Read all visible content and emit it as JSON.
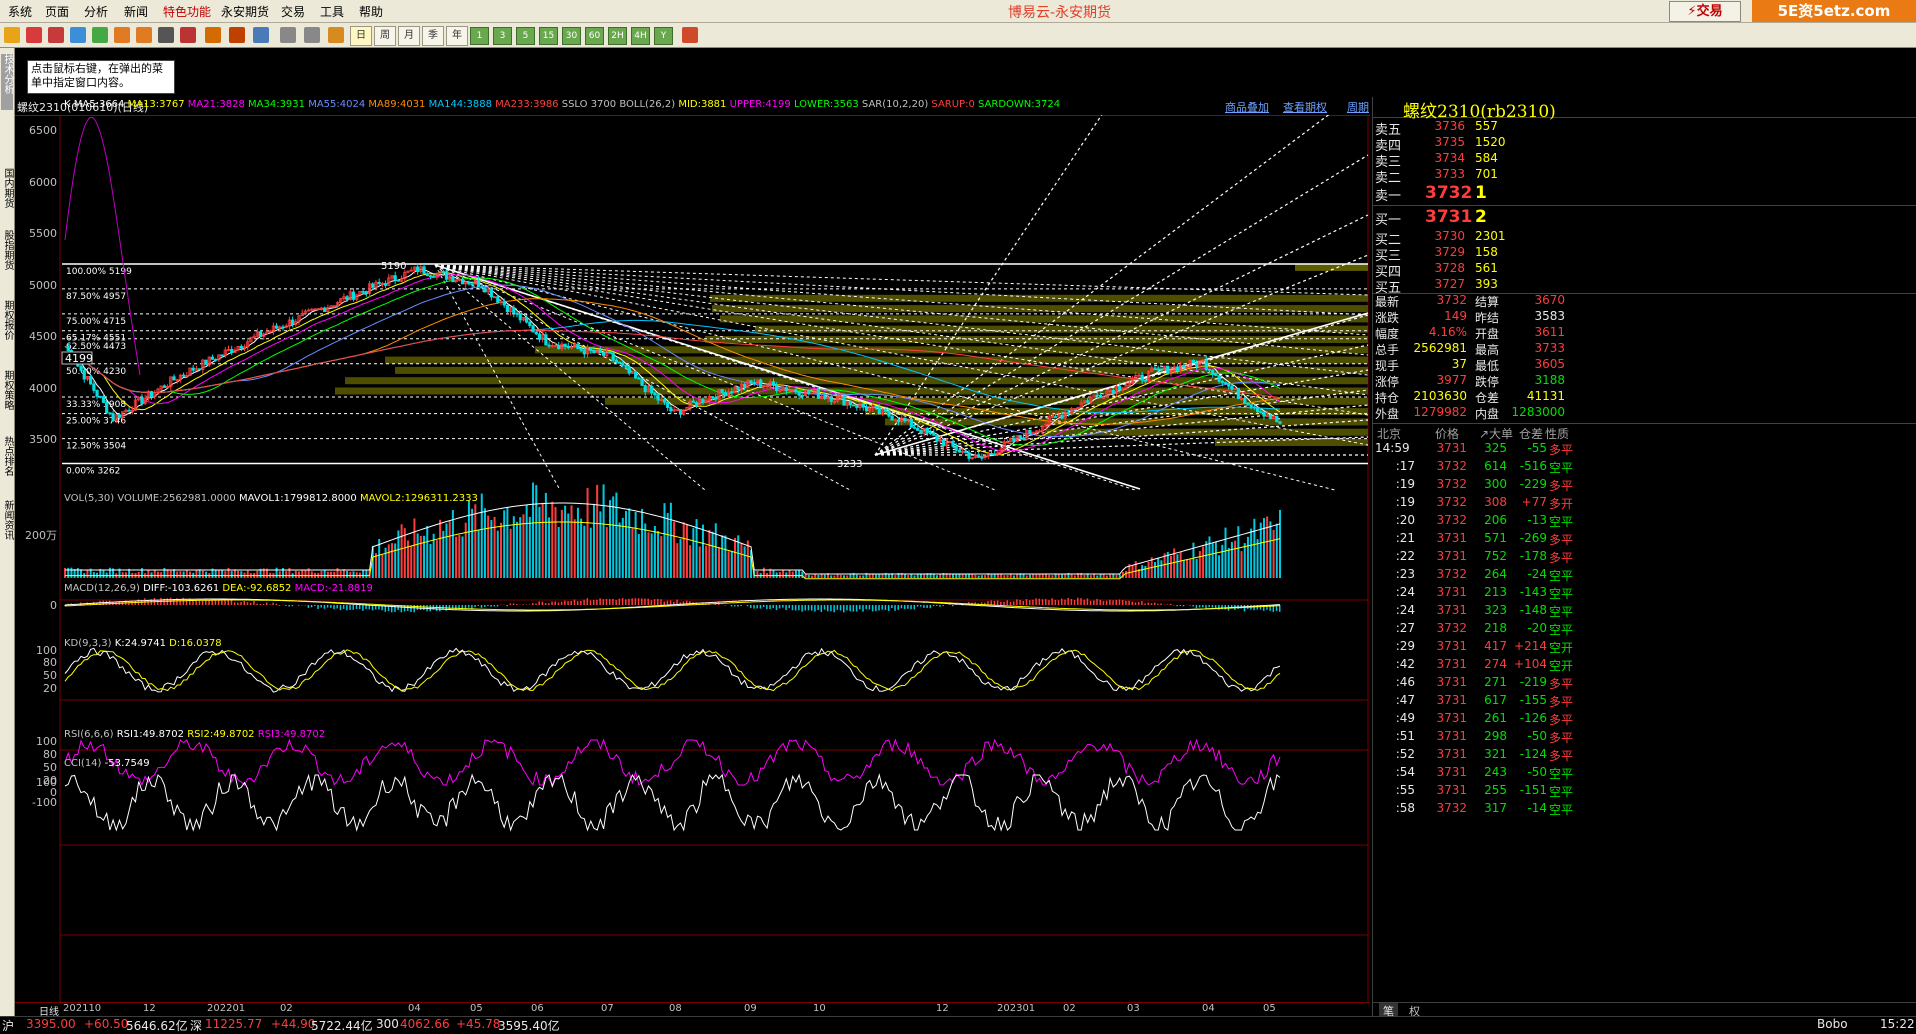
{
  "menu": {
    "items": [
      "系统",
      "页面",
      "分析",
      "新闻",
      "特色功能",
      "永安期货",
      "交易",
      "工具",
      "帮助"
    ],
    "app_title": "博易云-永安期货",
    "trade_button": "交易",
    "watermark": "5E资5etz.com"
  },
  "toolbar": {
    "period_buttons": [
      "日",
      "周",
      "月",
      "季",
      "年",
      "1",
      "3",
      "5",
      "15",
      "30",
      "60",
      "2H",
      "4H",
      "Y"
    ]
  },
  "sidebar": {
    "tabs": [
      "技术分析",
      "国内期货",
      "股指期货",
      "期权报价",
      "期权策略",
      "热点排名",
      "新闻资讯"
    ]
  },
  "tooltip": "点击鼠标右键，在弹出的菜单中指定窗口内容。",
  "chart_header": {
    "title": "螺纹2310(010610)(日线)",
    "links": [
      "商品叠加",
      "查看期权",
      "周期"
    ]
  },
  "indicators": {
    "main_k": "K",
    "ma5": "MA5:3664",
    "ma13": "MA13:3767",
    "ma21": "MA21:3828",
    "ma34": "MA34:3931",
    "ma55": "MA55:4024",
    "ma89": "MA89:4031",
    "ma144": "MA144:3888",
    "ma233": "MA233:3986",
    "sslo": "SSLO 3700",
    "boll": "BOLL(26,2)",
    "mid": "MID:3881",
    "upper": "UPPER:4199",
    "lower": "LOWER:3563",
    "sar": "SAR(10,2,20)",
    "sarup": "SARUP:0",
    "sardown": "SARDOWN:3724",
    "vol": "VOL(5,30) VOLUME:2562981.0000",
    "mavol1": "MAVOL1:1799812.8000",
    "mavol2": "MAVOL2:1296311.2333",
    "macd_name": "MACD(12,26,9)",
    "diff": "DIFF:-103.6261",
    "dea": "DEA:-92.6852",
    "macd": "MACD:-21.8819",
    "kd_name": "KD(9,3,3)",
    "k": "K:24.9741",
    "d": "D:16.0378",
    "rsi_name": "RSI(6,6,6)",
    "rsi1": "RSI1:49.8702",
    "rsi2": "RSI2:49.8702",
    "rsi3": "RSI3:49.8702",
    "cci_name": "CCI(14)",
    "cci": "-53.7549"
  },
  "price_axis": [
    "6500",
    "6000",
    "5500",
    "5000",
    "4500",
    "4000",
    "3500"
  ],
  "price_marker": "4199",
  "fib_levels": [
    {
      "pct": "100.00%",
      "value": "5199"
    },
    {
      "pct": "87.50%",
      "value": "4957"
    },
    {
      "pct": "75.00%",
      "value": "4715"
    },
    {
      "pct": "65.17%",
      "value": "4551"
    },
    {
      "pct": "62.50%",
      "value": "4473"
    },
    {
      "pct": "50.00%",
      "value": "4230"
    },
    {
      "pct": "33.33%",
      "value": "3908"
    },
    {
      "pct": "25.00%",
      "value": "3746"
    },
    {
      "pct": "12.50%",
      "value": "3504"
    },
    {
      "pct": "0.00%",
      "value": "3262"
    }
  ],
  "chart_labels": {
    "high": "5190",
    "low": "3233"
  },
  "vol_axis": "200万",
  "macd_axis": "0",
  "kd_axis": [
    "100",
    "80",
    "50",
    "20"
  ],
  "rsi_axis": [
    "100",
    "80",
    "50",
    "20"
  ],
  "cci_axis": [
    "100",
    "0",
    "-100"
  ],
  "date_axis": {
    "label": "日线",
    "ticks": [
      "202110",
      "12",
      "202201",
      "02",
      "04",
      "05",
      "06",
      "07",
      "08",
      "09",
      "10",
      "12",
      "202301",
      "02",
      "03",
      "04",
      "05"
    ]
  },
  "quote": {
    "title": "螺纹2310(rb2310)",
    "asks": [
      {
        "label": "卖五",
        "price": "3736",
        "vol": "557"
      },
      {
        "label": "卖四",
        "price": "3735",
        "vol": "1520"
      },
      {
        "label": "卖三",
        "price": "3734",
        "vol": "584"
      },
      {
        "label": "卖二",
        "price": "3733",
        "vol": "701"
      },
      {
        "label": "卖一",
        "price": "3732",
        "vol": "1"
      }
    ],
    "bids": [
      {
        "label": "买一",
        "price": "3731",
        "vol": "2"
      },
      {
        "label": "买二",
        "price": "3730",
        "vol": "2301"
      },
      {
        "label": "买三",
        "price": "3729",
        "vol": "158"
      },
      {
        "label": "买四",
        "price": "3728",
        "vol": "561"
      },
      {
        "label": "买五",
        "price": "3727",
        "vol": "393"
      }
    ],
    "stats": [
      {
        "l1": "最新",
        "v1": "3732",
        "l2": "结算",
        "v2": "3670"
      },
      {
        "l1": "涨跌",
        "v1": "149",
        "l2": "昨结",
        "v2": "3583"
      },
      {
        "l1": "幅度",
        "v1": "4.16%",
        "l2": "开盘",
        "v2": "3611"
      },
      {
        "l1": "总手",
        "v1": "2562981",
        "l2": "最高",
        "v2": "3733"
      },
      {
        "l1": "现手",
        "v1": "37",
        "l2": "最低",
        "v2": "3605"
      },
      {
        "l1": "涨停",
        "v1": "3977",
        "l2": "跌停",
        "v2": "3188"
      },
      {
        "l1": "持仓",
        "v1": "2103630",
        "l2": "仓差",
        "v2": "41131"
      },
      {
        "l1": "外盘",
        "v1": "1279982",
        "l2": "内盘",
        "v2": "1283000"
      }
    ],
    "ticks_header": [
      "北京",
      "价格",
      "↗大单",
      "仓差",
      "性质"
    ],
    "ticks": [
      {
        "t": "14:59",
        "p": "3731",
        "v": "325",
        "d": "-55",
        "n": "多平"
      },
      {
        "t": ":17",
        "p": "3732",
        "v": "614",
        "d": "-516",
        "n": "空平"
      },
      {
        "t": ":19",
        "p": "3732",
        "v": "300",
        "d": "-229",
        "n": "多平"
      },
      {
        "t": ":19",
        "p": "3732",
        "v": "308",
        "d": "+77",
        "n": "多开"
      },
      {
        "t": ":20",
        "p": "3732",
        "v": "206",
        "d": "-13",
        "n": "空平"
      },
      {
        "t": ":21",
        "p": "3731",
        "v": "571",
        "d": "-269",
        "n": "多平"
      },
      {
        "t": ":22",
        "p": "3731",
        "v": "752",
        "d": "-178",
        "n": "多平"
      },
      {
        "t": ":23",
        "p": "3732",
        "v": "264",
        "d": "-24",
        "n": "空平"
      },
      {
        "t": ":24",
        "p": "3731",
        "v": "213",
        "d": "-143",
        "n": "空平"
      },
      {
        "t": ":24",
        "p": "3731",
        "v": "323",
        "d": "-148",
        "n": "空平"
      },
      {
        "t": ":27",
        "p": "3732",
        "v": "218",
        "d": "-20",
        "n": "空平"
      },
      {
        "t": ":29",
        "p": "3731",
        "v": "417",
        "d": "+214",
        "n": "空开"
      },
      {
        "t": ":42",
        "p": "3731",
        "v": "274",
        "d": "+104",
        "n": "空开"
      },
      {
        "t": ":46",
        "p": "3731",
        "v": "271",
        "d": "-219",
        "n": "多平"
      },
      {
        "t": ":47",
        "p": "3731",
        "v": "617",
        "d": "-155",
        "n": "多平"
      },
      {
        "t": ":49",
        "p": "3731",
        "v": "261",
        "d": "-126",
        "n": "多平"
      },
      {
        "t": ":51",
        "p": "3731",
        "v": "298",
        "d": "-50",
        "n": "多平"
      },
      {
        "t": ":52",
        "p": "3731",
        "v": "321",
        "d": "-124",
        "n": "多平"
      },
      {
        "t": ":54",
        "p": "3731",
        "v": "243",
        "d": "-50",
        "n": "空平"
      },
      {
        "t": ":55",
        "p": "3731",
        "v": "255",
        "d": "-151",
        "n": "空平"
      },
      {
        "t": ":58",
        "p": "3732",
        "v": "317",
        "d": "-14",
        "n": "空平"
      }
    ],
    "bottom_tabs": [
      "笔",
      "权"
    ]
  },
  "statusbar": {
    "items": [
      "沪",
      "3395.00",
      "+60.50",
      "5646.62亿",
      "深",
      "11225.77",
      "+44.90",
      "5722.44亿",
      "300",
      "4062.66",
      "+45.78",
      "3595.40亿"
    ],
    "right": [
      "Bobo",
      "15:22"
    ]
  },
  "colors": {
    "up": "#ff3c3c",
    "down": "#00e0e0",
    "ma5": "#ffffff",
    "ma13": "#ffff00",
    "ma21": "#ff00ff",
    "ma34": "#00ff00",
    "ma55": "#6a8cff",
    "ma89": "#ff8c00",
    "ma144": "#00c8ff",
    "ma233": "#ff4040",
    "fib_zone": "#6b6b00"
  }
}
